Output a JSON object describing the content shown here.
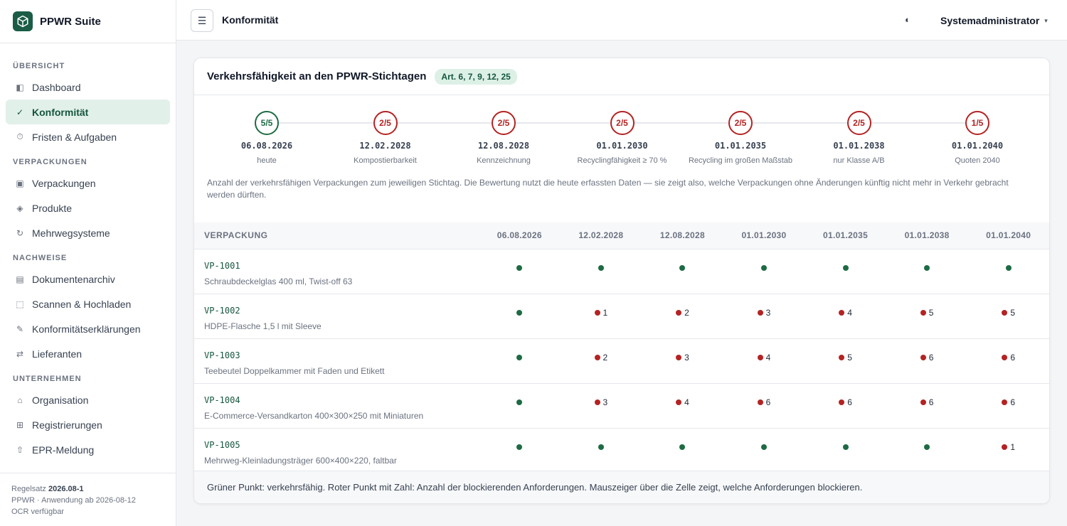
{
  "app": {
    "title": "PPWR Suite"
  },
  "sidebar": {
    "sections": [
      {
        "label": "ÜBERSICHT",
        "items": [
          {
            "label": "Dashboard",
            "icon": "dashboard-icon",
            "glyph": "◧"
          },
          {
            "label": "Konformität",
            "icon": "check-icon",
            "glyph": "✓",
            "active": true
          },
          {
            "label": "Fristen & Aufgaben",
            "icon": "timer-icon",
            "glyph": "⏱"
          }
        ]
      },
      {
        "label": "VERPACKUNGEN",
        "items": [
          {
            "label": "Verpackungen",
            "icon": "package-icon",
            "glyph": "▣"
          },
          {
            "label": "Produkte",
            "icon": "product-icon",
            "glyph": "◈"
          },
          {
            "label": "Mehrwegsysteme",
            "icon": "reuse-icon",
            "glyph": "↻"
          }
        ]
      },
      {
        "label": "NACHWEISE",
        "items": [
          {
            "label": "Dokumentenarchiv",
            "icon": "archive-icon",
            "glyph": "▤"
          },
          {
            "label": "Scannen & Hochladen",
            "icon": "scan-icon",
            "glyph": "⬚"
          },
          {
            "label": "Konformitätserklärungen",
            "icon": "pen-icon",
            "glyph": "✎"
          },
          {
            "label": "Lieferanten",
            "icon": "exchange-icon",
            "glyph": "⇄"
          }
        ]
      },
      {
        "label": "UNTERNEHMEN",
        "items": [
          {
            "label": "Organisation",
            "icon": "home-icon",
            "glyph": "⌂"
          },
          {
            "label": "Registrierungen",
            "icon": "grid-icon",
            "glyph": "⊞"
          },
          {
            "label": "EPR-Meldung",
            "icon": "upload-icon",
            "glyph": "⇧"
          }
        ]
      }
    ],
    "footer": {
      "ruleset_prefix": "Regelsatz ",
      "ruleset_version": "2026.08-1",
      "applies": "PPWR · Anwendung ab 2026-08-12",
      "ocr": "OCR verfügbar"
    }
  },
  "topbar": {
    "menu_glyph": "☰",
    "page_title": "Konformität",
    "theme_glyph": "◐",
    "user": "Systemadministrator",
    "caret": "▾"
  },
  "card": {
    "title": "Verkehrsfähigkeit an den PPWR-Stichtagen",
    "badge": "Art. 6, 7, 9, 12, 25",
    "timeline": [
      {
        "score": "5/5",
        "ok": true,
        "date": "06.08.2026",
        "label": "heute"
      },
      {
        "score": "2/5",
        "ok": false,
        "date": "12.02.2028",
        "label": "Kompostierbarkeit"
      },
      {
        "score": "2/5",
        "ok": false,
        "date": "12.08.2028",
        "label": "Kennzeichnung"
      },
      {
        "score": "2/5",
        "ok": false,
        "date": "01.01.2030",
        "label": "Recyclingfähigkeit ≥ 70 %"
      },
      {
        "score": "2/5",
        "ok": false,
        "date": "01.01.2035",
        "label": "Recycling im großen Maßstab"
      },
      {
        "score": "2/5",
        "ok": false,
        "date": "01.01.2038",
        "label": "nur Klasse A/B"
      },
      {
        "score": "1/5",
        "ok": false,
        "date": "01.01.2040",
        "label": "Quoten 2040"
      }
    ],
    "description": "Anzahl der verkehrsfähigen Verpackungen zum jeweiligen Stichtag. Die Bewertung nutzt die heute erfassten Daten — sie zeigt also, welche Verpackungen ohne Änderungen künftig nicht mehr in Verkehr gebracht werden dürften.",
    "table": {
      "columns": [
        "VERPACKUNG",
        "06.08.2026",
        "12.02.2028",
        "12.08.2028",
        "01.01.2030",
        "01.01.2035",
        "01.01.2038",
        "01.01.2040"
      ],
      "rows": [
        {
          "id": "VP-1001",
          "name": "Schraubdeckelglas 400 ml, Twist-off 63",
          "cells": [
            0,
            0,
            0,
            0,
            0,
            0,
            0
          ]
        },
        {
          "id": "VP-1002",
          "name": "HDPE-Flasche 1,5 l mit Sleeve",
          "cells": [
            0,
            1,
            2,
            3,
            4,
            5,
            5
          ]
        },
        {
          "id": "VP-1003",
          "name": "Teebeutel Doppelkammer mit Faden und Etikett",
          "cells": [
            0,
            2,
            3,
            4,
            5,
            6,
            6
          ]
        },
        {
          "id": "VP-1004",
          "name": "E-Commerce-Versandkarton 400×300×250 mit Miniaturen",
          "cells": [
            0,
            3,
            4,
            6,
            6,
            6,
            6
          ]
        },
        {
          "id": "VP-1005",
          "name": "Mehrweg-Kleinladungsträger 600×400×220, faltbar",
          "cells": [
            0,
            0,
            0,
            0,
            0,
            0,
            1
          ]
        }
      ]
    },
    "footer": "Grüner Punkt: verkehrsfähig. Roter Punkt mit Zahl: Anzahl der blockierenden Anforderungen. Mauszeiger über die Zelle zeigt, welche Anforderungen blockieren."
  },
  "colors": {
    "accent": "#1a5c45",
    "ok": "#1d6b43",
    "blocked": "#b42323"
  }
}
